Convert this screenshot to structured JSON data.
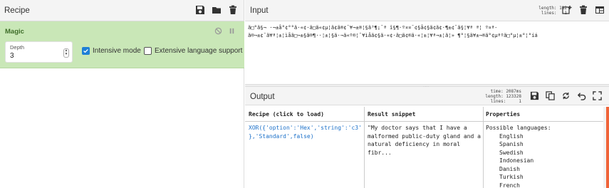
{
  "recipe": {
    "title": "Recipe",
    "icons": [
      "save-icon",
      "folder-icon",
      "trash-icon"
    ],
    "operation": {
      "name": "Magic",
      "icons": [
        "disable-icon",
        "pause-icon"
      ],
      "depth_label": "Depth",
      "depth_value": "3",
      "intensive_label": "Intensive mode",
      "intensive_checked": true,
      "extensive_label": "Extensive language support",
      "extensive_checked": false
    }
  },
  "input": {
    "title": "Input",
    "stats": "length: 182\nlines:   1",
    "icons": [
      "add-tab-icon",
      "trash-icon",
      "layout-icon"
    ],
    "text_line1": "ã□°ã§¬ ·¬±å°¢°°ã·«¢·ã□ã«¢µ¦ã¢ã®¢¯¥¬±®¦§ã³¶¡¯ª î§¶·º¤¤¯¢§å¢§ã¢ã¢·¶±¢¯ã§¦¥ª ª¦ º¤ª-",
    "text_line2": "ã®¬±¢¯ã¥ª¦±¦ìåã□¬±§ã®¶··¦±¦§ã·¬ã«º®¦¯¥ìåã¢§ã·«¢·ã□ã¢®ã·«¦±¦¥ª¬±¦ã¦» ¶°¦§ã¥±¬®ã°¢µªºã□°µ¦±°¦°íá"
  },
  "output": {
    "title": "Output",
    "stats": "time: 2087ms\nlength: 123328\nlines:     1",
    "icons": [
      "save-icon",
      "copy-icon",
      "switch-icon",
      "undo-icon",
      "maximize-icon"
    ],
    "columns": [
      "Recipe (click to load)",
      "Result snippet",
      "Properties"
    ],
    "recipe_text": "XOR({'option':'Hex','string':'c3'\n},'Standard',false)",
    "snippet_text": "\"My doctor says that I have a\nmalformed public-duty gland and a\nnatural deficiency in moral\nfibr...",
    "properties_title": "Possible languages:",
    "languages": [
      "English",
      "Spanish",
      "Swedish",
      "Indonesian",
      "Danish",
      "Turkish",
      "French"
    ]
  }
}
